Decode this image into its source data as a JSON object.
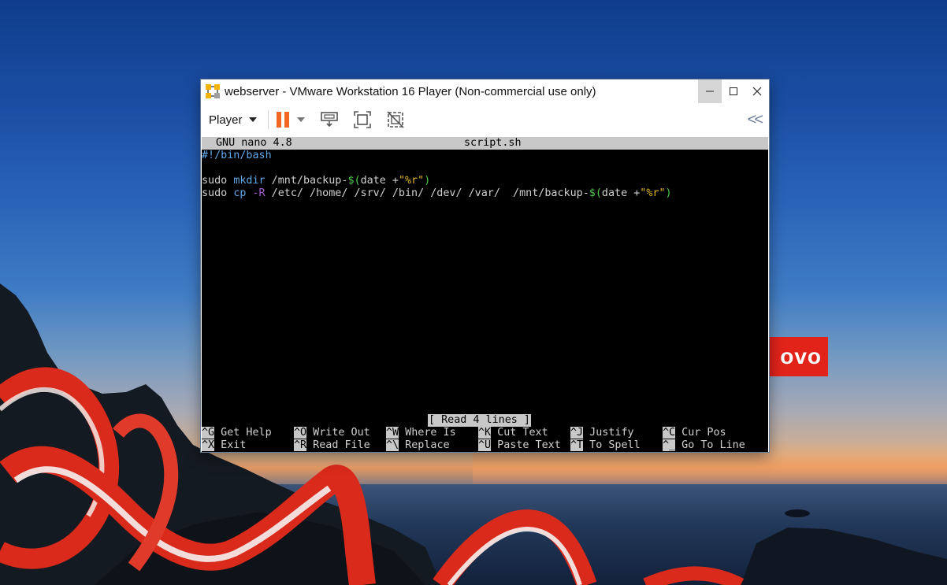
{
  "window": {
    "title": "webserver - VMware Workstation 16 Player (Non-commercial use only)",
    "minimize_icon": "minimize-icon",
    "maximize_icon": "maximize-icon",
    "close_icon": "close-icon"
  },
  "toolbar": {
    "player_label": "Player",
    "icons": [
      "pause-icon",
      "send-ctrl-alt-del-icon",
      "fullscreen-icon",
      "unity-icon",
      "collapse-toolbar-icon"
    ]
  },
  "nano": {
    "version": "GNU nano 4.8",
    "filename": "script.sh",
    "lines": {
      "l1": "#!/bin/bash",
      "l3_sudo": "sudo ",
      "l3_mkdir": "mkdir",
      "l3_path": " /mnt/backup-",
      "l3_dollar": "$(",
      "l3_date": "date +",
      "l3_q1": "\"",
      "l3_fmt": "%r",
      "l3_q2": "\"",
      "l3_close": ")",
      "l4_sudo": "sudo ",
      "l4_cp": "cp",
      "l4_flag": " -R",
      "l4_paths": " /etc/ /home/ /srv/ /bin/ /dev/ /var/  /mnt/backup-",
      "l4_dollar": "$(",
      "l4_date": "date +",
      "l4_q1": "\"",
      "l4_fmt": "%r",
      "l4_q2": "\"",
      "l4_close": ")"
    },
    "status": "[ Read 4 lines ]",
    "shortcuts_row1": [
      {
        "key": "^G",
        "label": " Get Help"
      },
      {
        "key": "^O",
        "label": " Write Out"
      },
      {
        "key": "^W",
        "label": " Where Is"
      },
      {
        "key": "^K",
        "label": " Cut Text"
      },
      {
        "key": "^J",
        "label": " Justify"
      },
      {
        "key": "^C",
        "label": " Cur Pos"
      }
    ],
    "shortcuts_row2": [
      {
        "key": "^X",
        "label": " Exit"
      },
      {
        "key": "^R",
        "label": " Read File"
      },
      {
        "key": "^\\",
        "label": " Replace"
      },
      {
        "key": "^U",
        "label": " Paste Text"
      },
      {
        "key": "^T",
        "label": " To Spell"
      },
      {
        "key": "^_",
        "label": " Go To Line"
      }
    ]
  },
  "desktop": {
    "badge_text": "ovo",
    "colors": {
      "badge": "#e2231a",
      "accent_pause": "#f26522",
      "sky": "#1a4ea3"
    }
  }
}
